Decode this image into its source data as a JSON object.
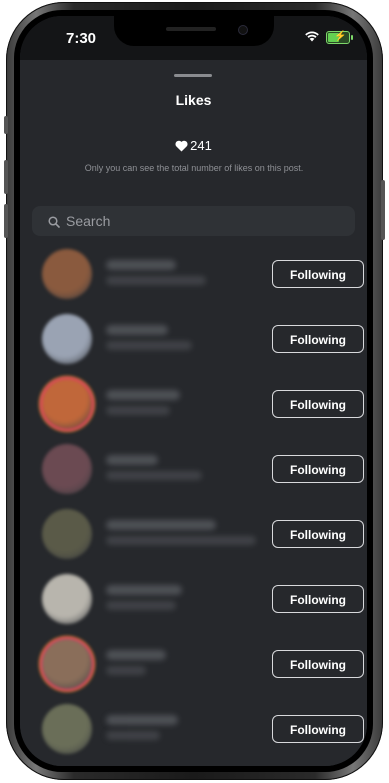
{
  "status_bar": {
    "time": "7:30",
    "battery_color": "#63d052",
    "battery_level": 0.6,
    "icons": [
      "wifi-icon",
      "battery-charging-icon"
    ]
  },
  "sheet": {
    "title": "Likes",
    "likes_count": "241",
    "privacy_note": "Only you can see the total number of likes on this post.",
    "search_placeholder": "Search"
  },
  "users": [
    {
      "button_label": "Following",
      "avatar_color": "#8a5a3e",
      "story_ring": false
    },
    {
      "button_label": "Following",
      "avatar_color": "#9aa3b3",
      "story_ring": false
    },
    {
      "button_label": "Following",
      "avatar_color": "#c0673a",
      "story_ring": true
    },
    {
      "button_label": "Following",
      "avatar_color": "#6b4a52",
      "story_ring": false
    },
    {
      "button_label": "Following",
      "avatar_color": "#5a5a48",
      "story_ring": false
    },
    {
      "button_label": "Following",
      "avatar_color": "#b8b5ad",
      "story_ring": false
    },
    {
      "button_label": "Following",
      "avatar_color": "#8a6e5a",
      "story_ring": true
    },
    {
      "button_label": "Following",
      "avatar_color": "#6a6e58",
      "story_ring": false
    }
  ],
  "colors": {
    "background": "#26282c",
    "text": "#ffffff",
    "muted_text": "#8e9095",
    "button_border": "#d8d9dc",
    "story_ring_pink": "#e2336b",
    "story_ring_orange": "#f5a623"
  }
}
